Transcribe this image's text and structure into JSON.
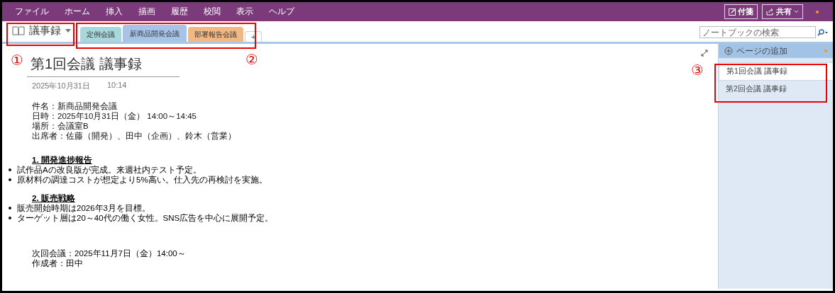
{
  "menu": [
    "ファイル",
    "ホーム",
    "挿入",
    "描画",
    "履歴",
    "校閲",
    "表示",
    "ヘルプ"
  ],
  "title_buttons": [
    {
      "label": "付箋",
      "kind": "sticky"
    },
    {
      "label": "共有",
      "kind": "share"
    }
  ],
  "notebook": {
    "name": "議事録"
  },
  "section_tabs": [
    {
      "label": "定例会議",
      "color": "#a6d8dc",
      "selected": false
    },
    {
      "label": "新商品開発会議",
      "color": "#a7c4e8",
      "selected": true
    },
    {
      "label": "部署報告会議",
      "color": "#f2b883",
      "selected": false
    }
  ],
  "add_tab": "+",
  "search": {
    "placeholder": "ノートブックの検索"
  },
  "page": {
    "title": "第1回会議 議事録",
    "date": "2025年10月31日",
    "time": "10:14",
    "info": [
      "件名：新商品開発会議",
      "日時：2025年10月31日（金） 14:00～14:45",
      "場所：会議室B",
      "出席者：佐藤（開発）、田中（企画）、鈴木（営業）"
    ],
    "sections": [
      {
        "heading": "1. 開発進捗報告",
        "bullets": [
          "試作品Aの改良版が完成。来週社内テスト予定。",
          "原材料の調達コストが想定より5%高い。仕入先の再検討を実施。"
        ]
      },
      {
        "heading": "2. 販売戦略",
        "bullets": [
          "販売開始時期は2026年3月を目標。",
          "ターゲット層は20～40代の働く女性。SNS広告を中心に展開予定。"
        ]
      }
    ],
    "footer": [
      "次回会議：2025年11月7日（金）14:00～",
      "作成者：田中"
    ]
  },
  "pages_panel": {
    "add_label": "ページの追加",
    "pages": [
      {
        "title": "第1回会議 議事録",
        "selected": true
      },
      {
        "title": "第2回会議 議事録",
        "selected": false
      }
    ]
  },
  "callouts": [
    "①",
    "②",
    "③"
  ]
}
